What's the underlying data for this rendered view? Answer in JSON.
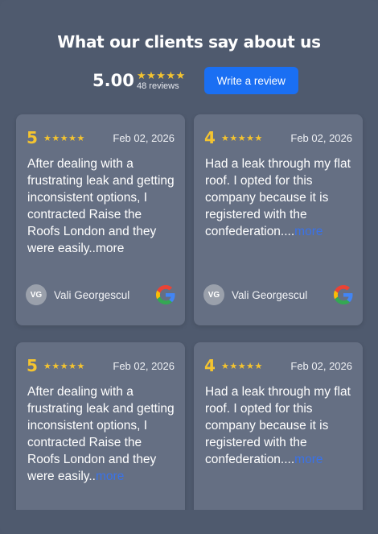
{
  "header": {
    "title": "What our clients say about us",
    "average": "5.00",
    "stars": "★★★★★",
    "review_count": "48 reviews",
    "write_button": "Write a review"
  },
  "colors": {
    "star": "#f4c430",
    "button": "#1a6ff3",
    "card": "#656f83",
    "background": "#4f5a6e",
    "link": "#3a72e8"
  },
  "reviews": [
    {
      "rating": "5",
      "stars": "★★★★★",
      "date": "Feb 02, 2026",
      "text": "After dealing with a frustrating leak and getting inconsistent options, I contracted Raise the Roofs London and they were easily..",
      "more": "more",
      "reviewer_initials": "VG",
      "reviewer_name": "Vali Georgescul",
      "source_icon": "google-icon"
    },
    {
      "rating": "4",
      "stars": "★★★★★",
      "date": "Feb 02, 2026",
      "text": "Had a leak through my flat roof. I opted for this company because it is registered with the confederation....",
      "more": "more",
      "reviewer_initials": "VG",
      "reviewer_name": "Vali Georgescul",
      "source_icon": "google-icon"
    },
    {
      "rating": "5",
      "stars": "★★★★★",
      "date": "Feb 02, 2026",
      "text": "After dealing with a frustrating leak and getting inconsistent options, I contracted Raise the Roofs London and they were easily..",
      "more": "more"
    },
    {
      "rating": "4",
      "stars": "★★★★★",
      "date": "Feb 02, 2026",
      "text": "Had a leak through my flat roof. I opted for this company because it is registered with the confederation....",
      "more": "more"
    }
  ]
}
